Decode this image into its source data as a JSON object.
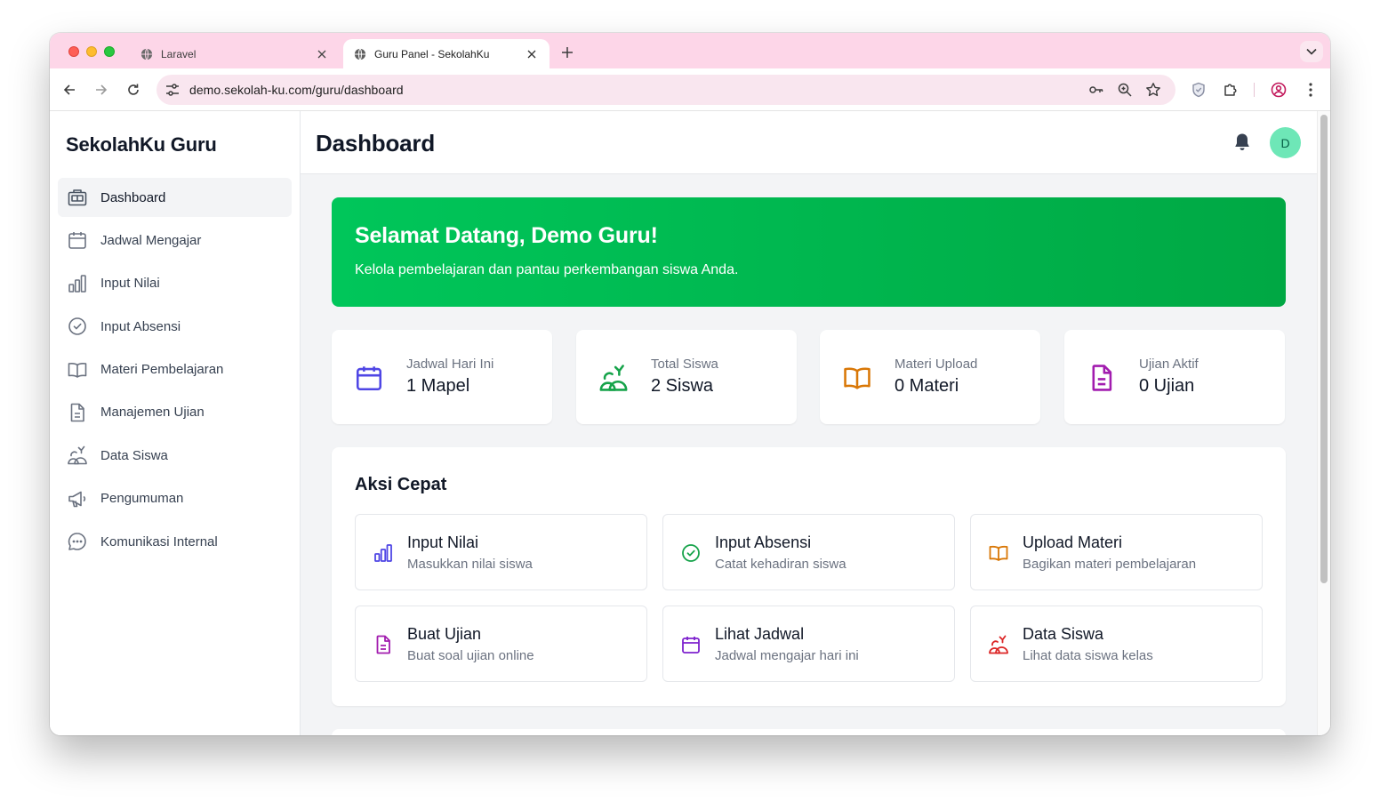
{
  "browser": {
    "tabs": [
      {
        "title": "Laravel",
        "active": false
      },
      {
        "title": "Guru Panel - SekolahKu",
        "active": true
      }
    ],
    "url": "demo.sekolah-ku.com/guru/dashboard"
  },
  "sidebar": {
    "brand": "SekolahKu Guru",
    "items": [
      {
        "label": "Dashboard",
        "icon": "briefcase-icon",
        "active": true
      },
      {
        "label": "Jadwal Mengajar",
        "icon": "calendar-icon"
      },
      {
        "label": "Input Nilai",
        "icon": "bar-chart-icon"
      },
      {
        "label": "Input Absensi",
        "icon": "check-circle-icon"
      },
      {
        "label": "Materi Pembelajaran",
        "icon": "book-open-icon"
      },
      {
        "label": "Manajemen Ujian",
        "icon": "document-icon"
      },
      {
        "label": "Data Siswa",
        "icon": "users-icon"
      },
      {
        "label": "Pengumuman",
        "icon": "megaphone-icon"
      },
      {
        "label": "Komunikasi Internal",
        "icon": "chat-bubble-icon"
      }
    ]
  },
  "header": {
    "title": "Dashboard",
    "avatar_initial": "D"
  },
  "welcome": {
    "title": "Selamat Datang, Demo Guru!",
    "subtitle": "Kelola pembelajaran dan pantau perkembangan siswa Anda."
  },
  "stats": [
    {
      "label": "Jadwal Hari Ini",
      "value": "1 Mapel",
      "icon": "calendar-icon",
      "color": "#4f46e5"
    },
    {
      "label": "Total Siswa",
      "value": "2 Siswa",
      "icon": "users-icon",
      "color": "#16a34a"
    },
    {
      "label": "Materi Upload",
      "value": "0 Materi",
      "icon": "book-open-icon",
      "color": "#d97706"
    },
    {
      "label": "Ujian Aktif",
      "value": "0 Ujian",
      "icon": "document-icon",
      "color": "#a21caf"
    }
  ],
  "quick_actions": {
    "title": "Aksi Cepat",
    "items": [
      {
        "title": "Input Nilai",
        "desc": "Masukkan nilai siswa",
        "icon": "bar-chart-icon",
        "color": "#4f46e5"
      },
      {
        "title": "Input Absensi",
        "desc": "Catat kehadiran siswa",
        "icon": "check-circle-icon",
        "color": "#16a34a"
      },
      {
        "title": "Upload Materi",
        "desc": "Bagikan materi pembelajaran",
        "icon": "book-open-icon",
        "color": "#d97706"
      },
      {
        "title": "Buat Ujian",
        "desc": "Buat soal ujian online",
        "icon": "document-icon",
        "color": "#a21caf"
      },
      {
        "title": "Lihat Jadwal",
        "desc": "Jadwal mengajar hari ini",
        "icon": "calendar-icon",
        "color": "#7e22ce"
      },
      {
        "title": "Data Siswa",
        "desc": "Lihat data siswa kelas",
        "icon": "users-icon",
        "color": "#dc2626"
      }
    ]
  },
  "colors": {
    "welcome_gradient_start": "#00c65a",
    "welcome_gradient_end": "#00a844",
    "avatar_bg": "#6ee7b7",
    "tabstrip_bg": "#fdd6e8"
  }
}
